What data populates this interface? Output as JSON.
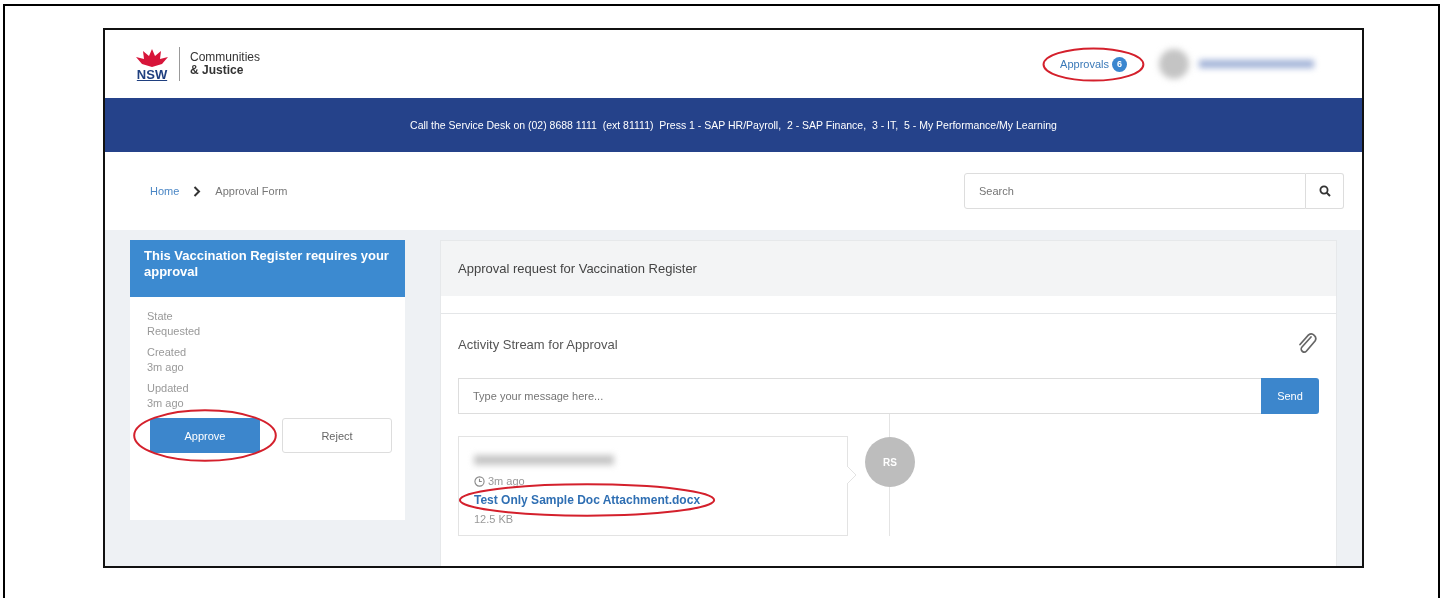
{
  "header": {
    "logo": {
      "wordmark": "NSW",
      "department_line_1": "Communities",
      "department_line_2": "& Justice"
    },
    "approvals": {
      "label": "Approvals",
      "count": "6",
      "circled": true
    }
  },
  "banner": "Call the Service Desk on (02) 8688 1111  (ext 81111)  Press 1 - SAP HR/Payroll,  2 - SAP Finance,  3 - IT,  5 - My Performance/My Learning",
  "breadcrumb": [
    {
      "label": "Home",
      "kind": "link"
    },
    {
      "label": "Approval Form",
      "kind": "current"
    }
  ],
  "search": {
    "placeholder": "Search"
  },
  "summary_card": {
    "title": "This Vaccination Register requires your approval",
    "fields": [
      {
        "label": "State",
        "value": "Requested"
      },
      {
        "label": "Created",
        "value": "3m ago"
      },
      {
        "label": "Updated",
        "value": "3m ago"
      }
    ],
    "buttons": [
      {
        "label": "Approve",
        "kind": "primary",
        "circled": true
      },
      {
        "label": "Reject",
        "kind": "default",
        "circled": false
      }
    ]
  },
  "request_panel": {
    "title": "Approval request for Vaccination Register"
  },
  "activity": {
    "title": "Activity Stream for Approval",
    "message": {
      "placeholder": "Type your message here..."
    },
    "send_button": "Send",
    "entries": [
      {
        "time": "3m ago",
        "attachment": "Test Only Sample Doc Attachment.docx",
        "size": "12.5 KB",
        "initials": "RS",
        "circled": true
      }
    ]
  }
}
